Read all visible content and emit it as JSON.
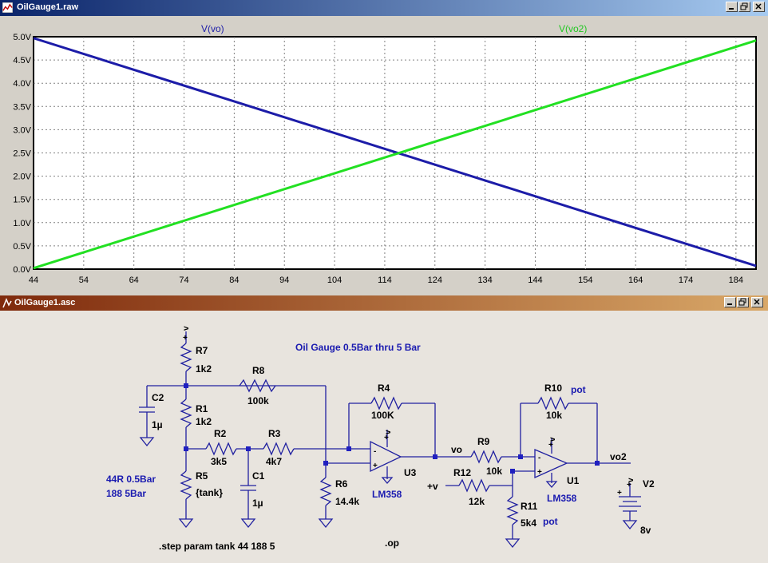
{
  "waveform_window": {
    "title": "OilGauge1.raw",
    "trace_labels": [
      "V(vo)",
      "V(vo2)"
    ]
  },
  "schematic_window": {
    "title": "OilGauge1.asc",
    "heading": "Oil Gauge 0.5Bar thru 5 Bar",
    "note_left_1": "44R 0.5Bar",
    "note_left_2": "188 5Bar",
    "step_directive": ".step param tank 44 188 5",
    "op_directive": ".op",
    "components": {
      "R7": "R7",
      "R7v": "1k2",
      "R1": "R1",
      "R1v": "1k2",
      "R8": "R8",
      "R8v": "100k",
      "R2": "R2",
      "R2v": "3k5",
      "R3": "R3",
      "R3v": "4k7",
      "R4": "R4",
      "R4v": "100K",
      "R5": "R5",
      "R5v": "{tank}",
      "R6": "R6",
      "R6v": "14.4k",
      "R9": "R9",
      "R9v": "10k",
      "R10": "R10",
      "R10v": "10k",
      "R10note": "pot",
      "R11": "R11",
      "R11v": "5k4",
      "R11note": "pot",
      "R12": "R12",
      "R12v": "12k",
      "C1": "C1",
      "C1v": "1µ",
      "C2": "C2",
      "C2v": "1µ",
      "U1": "U1",
      "U1v": "LM358",
      "U3": "U3",
      "U3v": "LM358",
      "V2": "V2",
      "V2v": "8v"
    },
    "net_labels": {
      "vo": "vo",
      "vo2": "vo2",
      "plusv": "+v",
      "v_top": "v"
    }
  },
  "chart_data": {
    "type": "line",
    "x": [
      44,
      188
    ],
    "x_ticks": [
      "44",
      "54",
      "64",
      "74",
      "84",
      "94",
      "104",
      "114",
      "124",
      "134",
      "144",
      "154",
      "164",
      "174",
      "184"
    ],
    "y_ticks": [
      "0.0V",
      "0.5V",
      "1.0V",
      "1.5V",
      "2.0V",
      "2.5V",
      "3.0V",
      "3.5V",
      "4.0V",
      "4.5V",
      "5.0V"
    ],
    "xlim": [
      44,
      188
    ],
    "ylim": [
      0,
      5.0
    ],
    "grid": true,
    "series": [
      {
        "name": "V(vo)",
        "color": "#1c1ca8",
        "x": [
          44,
          188
        ],
        "y": [
          4.97,
          0.07
        ]
      },
      {
        "name": "V(vo2)",
        "color": "#22e022",
        "x": [
          44,
          188
        ],
        "y": [
          0.02,
          4.92
        ]
      }
    ]
  },
  "colors": {
    "title_active": "#0a246a",
    "title_inactive": "#7f2a0c",
    "schematic_text": "#1a1ab0",
    "wire": "#2020a0",
    "junction": "#2020c0"
  }
}
